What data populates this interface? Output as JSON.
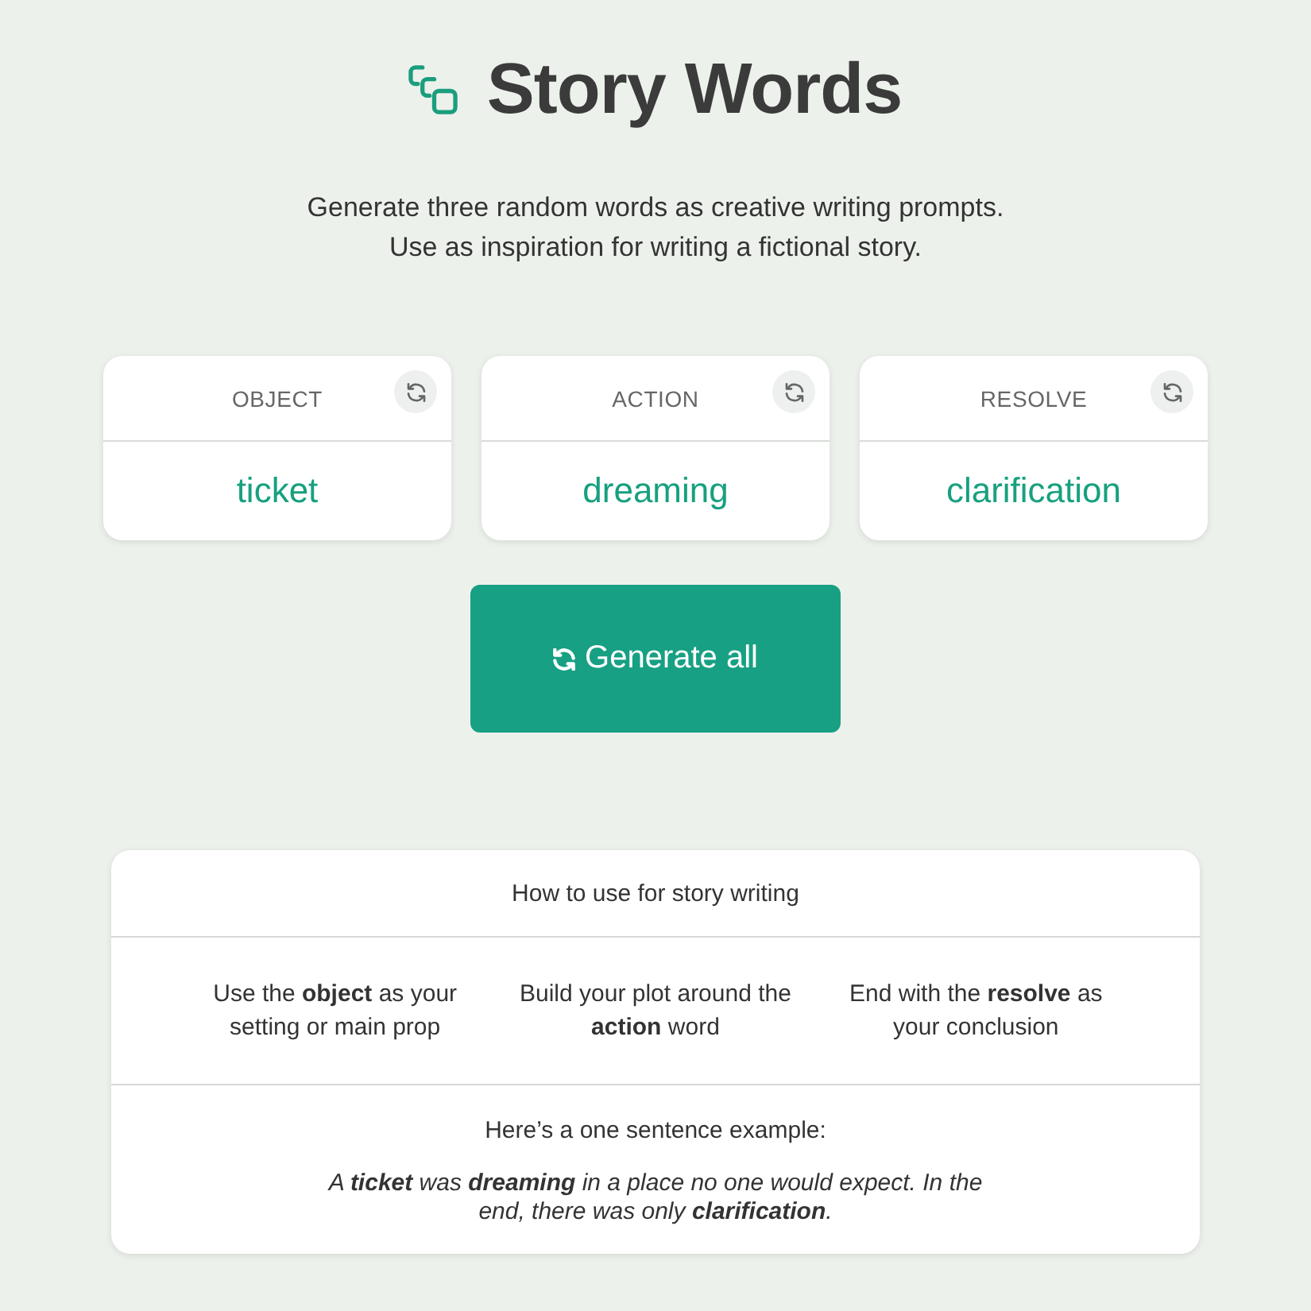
{
  "header": {
    "title": "Story Words",
    "subtitle_lines": [
      "Generate three random words as creative writing prompts.",
      "Use as inspiration for writing a fictional story."
    ]
  },
  "word_cards": [
    {
      "label": "OBJECT",
      "word": "ticket"
    },
    {
      "label": "ACTION",
      "word": "dreaming"
    },
    {
      "label": "RESOLVE",
      "word": "clarification"
    }
  ],
  "generate_button": {
    "label": "Generate all"
  },
  "guide": {
    "title": "How to use for story writing",
    "tips": [
      "Use the **object** as your setting or main prop",
      "Build your plot around the **action** word",
      "End with the **resolve** as your conclusion"
    ],
    "example_heading": "Here’s a one sentence example:",
    "example": "A **ticket** was **dreaming** in a place no one would expect. In the end, there was only **clarification**."
  }
}
